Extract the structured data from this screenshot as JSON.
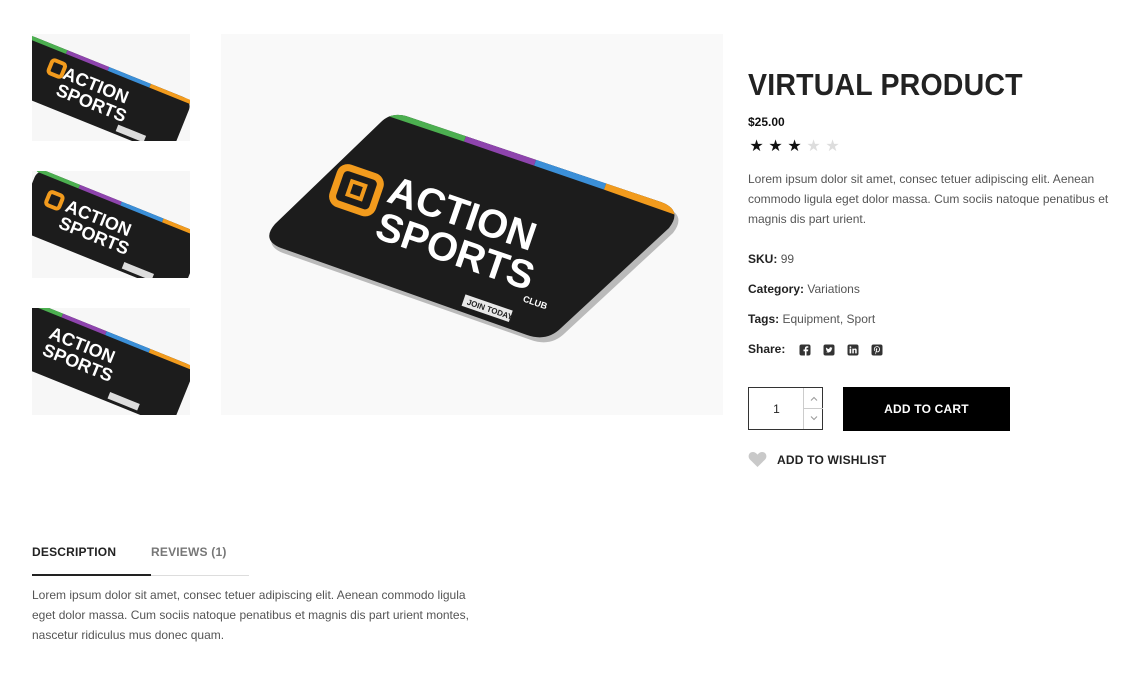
{
  "gallery": {
    "card_text": {
      "line1": "ACTION",
      "line2": "SPORTS",
      "club": "CLUB",
      "join": "JOIN TODAY"
    },
    "colors": {
      "card": "#1c1c1c",
      "green": "#4caf50",
      "purple": "#8e44ad",
      "blue": "#3b8fd8",
      "orange": "#f29b1d"
    }
  },
  "product": {
    "title": "VIRTUAL PRODUCT",
    "price": "$25.00",
    "rating": 3,
    "rating_max": 5,
    "description": "Lorem ipsum dolor sit amet, consec tetuer adipiscing elit. Aenean commodo ligula eget dolor massa. Cum sociis natoque penatibus et magnis dis part urient.",
    "sku_label": "SKU:",
    "sku_value": "99",
    "category_label": "Category:",
    "category_value": "Variations",
    "tags_label": "Tags:",
    "tags": [
      "Equipment",
      "Sport"
    ],
    "tag_separator": ",",
    "share_label": "Share:",
    "share_icons": [
      "facebook-icon",
      "twitter-icon",
      "linkedin-icon",
      "pinterest-icon"
    ]
  },
  "cart": {
    "quantity": "1",
    "add_to_cart_label": "ADD TO CART",
    "wishlist_label": "ADD TO WISHLIST"
  },
  "tabs": {
    "description_label": "DESCRIPTION",
    "reviews_label": "REVIEWS (1)",
    "description_text": "Lorem ipsum dolor sit amet, consec tetuer adipiscing elit. Aenean commodo ligula eget dolor massa. Cum sociis natoque penatibus et magnis dis part urient montes, nascetur ridiculus mus donec quam."
  }
}
